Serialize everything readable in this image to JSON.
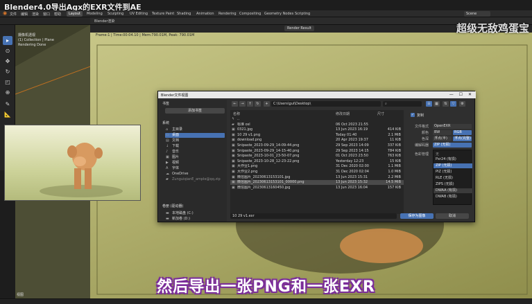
{
  "video_title": "Blender4.0导出Agx的EXR文件到AE",
  "menu": [
    "文件",
    "编辑",
    "渲染",
    "窗口",
    "帮助"
  ],
  "workspaces": [
    "Layout",
    "Modeling",
    "Sculpting",
    "UV Editing",
    "Texture Paint",
    "Shading",
    "Animation",
    "Rendering",
    "Compositing",
    "Geometry Nodes",
    "Scripting"
  ],
  "active_workspace": "Layout",
  "scene_name": "Scene",
  "viewport": {
    "line1": "摄像机透视",
    "line2": "(1) Collection | Plane",
    "line3": "Rendering Done"
  },
  "render": {
    "window_title": "Blender渲染",
    "slot": "Render Result",
    "frame_info": "Frame:1 | Time:00:04.10 | Mem:790.01M, Peak: 790.01M"
  },
  "corner_watermark": "超级无敌鸡蛋宝",
  "dialog": {
    "title": "Blender文件视图",
    "bookmarks_header": "书签",
    "add_bookmark": "添加书签",
    "system_header": "系统",
    "system_items": [
      {
        "label": "主目录",
        "icon": "home-icon"
      },
      {
        "label": "桌面",
        "icon": "desktop-icon"
      },
      {
        "label": "文档",
        "icon": "document-icon"
      },
      {
        "label": "下载",
        "icon": "download-icon"
      },
      {
        "label": "音乐",
        "icon": "music-icon"
      },
      {
        "label": "图片",
        "icon": "picture-icon"
      },
      {
        "label": "视频",
        "icon": "video-icon"
      },
      {
        "label": "字体",
        "icon": "font-icon"
      },
      {
        "label": "OneDrive",
        "icon": "cloud-icon"
      },
      {
        "label": "ZunguiqianE_ample@qq.zip",
        "icon": "folder-icon"
      }
    ],
    "active_system": "桌面",
    "volumes_header": "卷册 (驱动器)",
    "volumes": [
      {
        "label": "本地磁盘 (C:)",
        "icon": "drive-icon"
      },
      {
        "label": "新加卷 (D:)",
        "icon": "drive-icon"
      }
    ],
    "path": "C:\\Users\\gui\\Desktop\\",
    "search_placeholder": "",
    "columns": {
      "name": "名称",
      "date": "修改日期",
      "size": "尺寸"
    },
    "files": [
      {
        "name": "..",
        "date": "",
        "size": "",
        "icon": "folder-up-icon"
      },
      {
        "name": "标准 osl",
        "date": "06 Oct 2023 21:55",
        "size": "",
        "icon": "folder-icon"
      },
      {
        "name": "0321.jpg",
        "date": "13 Jun 2023 16:19",
        "size": "414 KiB",
        "icon": "image-file-icon"
      },
      {
        "name": "10 29 v1.png",
        "date": "Today 01:40",
        "size": "2.1 MiB",
        "icon": "image-file-icon"
      },
      {
        "name": "download.png",
        "date": "20 Apr 2023 19:37",
        "size": "11 KiB",
        "icon": "image-file-icon"
      },
      {
        "name": "Snipaste_2023-09-29_14-09-44.png",
        "date": "29 Sep 2023 14:09",
        "size": "337 KiB",
        "icon": "image-file-icon"
      },
      {
        "name": "Snipaste_2023-09-29_14-15-40.png",
        "date": "29 Sep 2023 14:15",
        "size": "784 KiB",
        "icon": "image-file-icon"
      },
      {
        "name": "Snipaste_2023-10-01_23-50-07.png",
        "date": "01 Oct 2023 23:50",
        "size": "763 KiB",
        "icon": "image-file-icon"
      },
      {
        "name": "Snipaste_2023-10-28_12-23-22.png",
        "date": "Yesterday 12:23",
        "size": "15 KiB",
        "icon": "image-file-icon"
      },
      {
        "name": "大作业1.png",
        "date": "31 Dec 2020 02:00",
        "size": "1.1 MiB",
        "icon": "image-file-icon"
      },
      {
        "name": "大作业2.png",
        "date": "31 Dec 2020 02:04",
        "size": "1.0 MiB",
        "icon": "image-file-icon"
      },
      {
        "name": "微信图片_20230613153101.jpg",
        "date": "13 Jun 2023 15:31",
        "size": "2.2 MiB",
        "icon": "image-file-icon"
      },
      {
        "name": "微信图片_20230613153101_00000.png",
        "date": "13 Jun 2023 15:32",
        "size": "14.5 MiB",
        "icon": "image-file-icon"
      },
      {
        "name": "微信图片_20230613160450.jpg",
        "date": "13 Jun 2023 16:04",
        "size": "157 KiB",
        "icon": "image-file-icon"
      }
    ],
    "selected_file": "微信图片_20230613153101_00000.png",
    "filename": "10 29 v1.exr",
    "save_label": "保存为图像",
    "cancel_label": "取消",
    "settings": {
      "copy_label": "复制",
      "format_label": "文件格式",
      "format_value": "OpenEXR",
      "color_label": "颜色",
      "color_options": [
        "BW",
        "RGB"
      ],
      "color_active": "RGB",
      "depth_label": "色深",
      "depth_options": [
        "浮点(半)",
        "浮点(完整)"
      ],
      "depth_active": "浮点(完整)",
      "codec_label": "编解码器",
      "codec_value": "ZIP (无损)",
      "color_mgmt_label": "色彩管理",
      "codec_list_title": "无",
      "codecs": [
        "Pxr24 (有损)",
        "ZIP (无损)",
        "PIZ (无损)",
        "RLE (无损)",
        "ZIPS (无损)",
        "DWAA (有损)",
        "DWAB (有损)"
      ],
      "codec_active": "ZIP (无损)",
      "codec_hover": "DWAA (有损)"
    }
  },
  "subtitle": "然后导出一张PNG和一张EXR",
  "bottom_left": "视图"
}
